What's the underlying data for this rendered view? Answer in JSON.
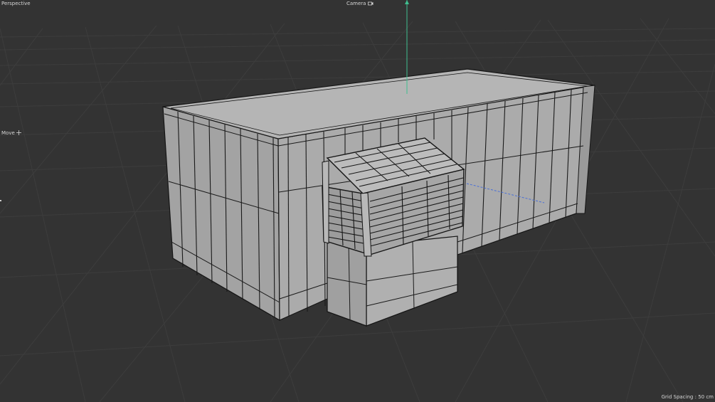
{
  "viewport": {
    "view_name": "Perspective",
    "camera_label": "Camera",
    "camera_icon": "camera-icon",
    "tool_label": "Move",
    "tool_icon": "move-crosshair-icon",
    "grid_label": "Grid Spacing",
    "grid_value": "50 cm"
  },
  "colors": {
    "background": "#333333",
    "grid_line": "#3d3d3d",
    "model_fill": "#a8a8a8",
    "wire": "#151515",
    "y_axis": "#3fbf8f",
    "x_axis": "#4a6fd6"
  }
}
